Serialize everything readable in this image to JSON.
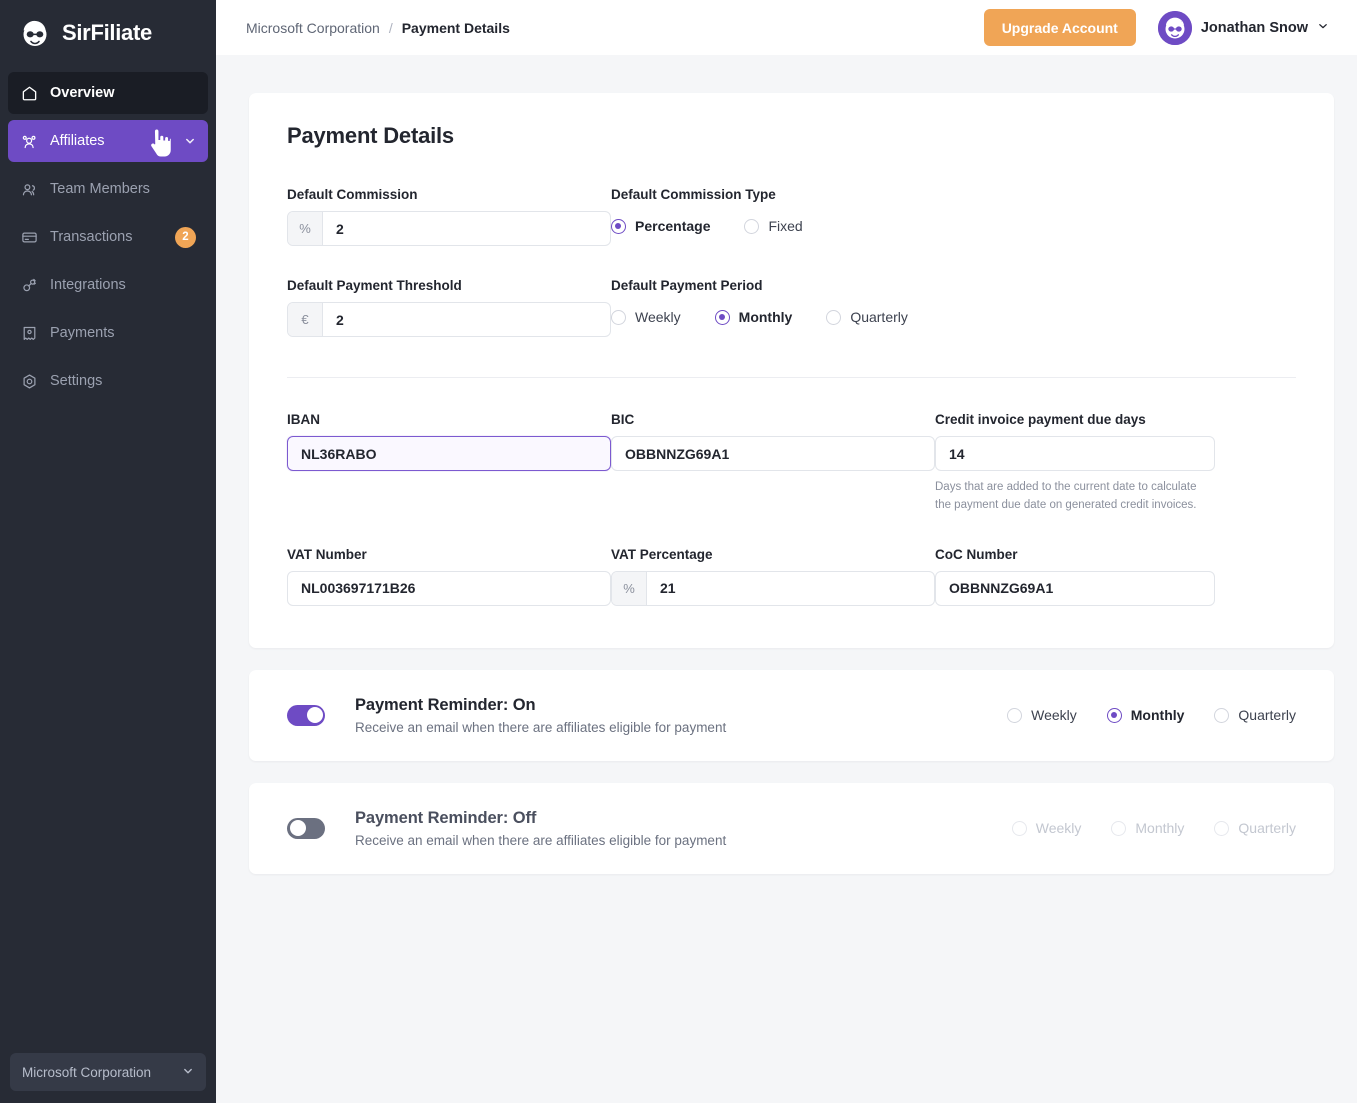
{
  "brand": {
    "name": "SirFiliate",
    "logo_icon": "mascot-logo-icon"
  },
  "sidebar": {
    "items": [
      {
        "label": "Overview",
        "icon": "home-icon",
        "state": "active-dark"
      },
      {
        "label": "Affiliates",
        "icon": "affiliates-group-icon",
        "state": "active-purple",
        "has_chevron": true
      },
      {
        "label": "Team Members",
        "icon": "team-members-icon",
        "state": "normal"
      },
      {
        "label": "Transactions",
        "icon": "card-icon",
        "state": "normal",
        "badge": "2"
      },
      {
        "label": "Integrations",
        "icon": "integrations-plug-icon",
        "state": "normal"
      },
      {
        "label": "Payments",
        "icon": "receipt-icon",
        "state": "normal"
      },
      {
        "label": "Settings",
        "icon": "gear-hexagon-icon",
        "state": "normal"
      }
    ],
    "org_switcher": {
      "label": "Microsoft Corporation",
      "icon": "chevron-down-icon"
    }
  },
  "header": {
    "breadcrumb_root": "Microsoft Corporation",
    "breadcrumb_separator": "/",
    "breadcrumb_current": "Payment Details",
    "upgrade_label": "Upgrade Account",
    "user_name": "Jonathan Snow",
    "user_caret_icon": "chevron-down-icon",
    "avatar_icon": "user-avatar-icon"
  },
  "main": {
    "page_title": "Payment Details",
    "fields": {
      "default_commission": {
        "label": "Default Commission",
        "prefix": "%",
        "value": "2",
        "placeholder": ""
      },
      "default_commission_type": {
        "label": "Default Commission Type",
        "options": [
          {
            "label": "Percentage",
            "checked": true
          },
          {
            "label": "Fixed",
            "checked": false
          }
        ]
      },
      "default_payment_threshold": {
        "label": "Default Payment Threshold",
        "prefix": "€",
        "value": "2",
        "placeholder": ""
      },
      "default_payment_period": {
        "label": "Default Payment Period",
        "options": [
          {
            "label": "Weekly",
            "checked": false
          },
          {
            "label": "Monthly",
            "checked": true
          },
          {
            "label": "Quarterly",
            "checked": false
          }
        ]
      },
      "iban": {
        "label": "IBAN",
        "value": "NL36RABO",
        "placeholder": "",
        "focused": true
      },
      "bic": {
        "label": "BIC",
        "value": "OBBNNZG69A1",
        "placeholder": ""
      },
      "credit_invoice_due_days": {
        "label": "Credit invoice payment due days",
        "value": "14",
        "placeholder": "",
        "hint": "Days that are added to the current date to calculate the payment due date on generated credit invoices."
      },
      "vat_number": {
        "label": "VAT Number",
        "value": "NL003697171B26",
        "placeholder": ""
      },
      "vat_percentage": {
        "label": "VAT Percentage",
        "prefix": "%",
        "value": "21",
        "placeholder": ""
      },
      "coc_number": {
        "label": "CoC Number",
        "value": "OBBNNZG69A1",
        "placeholder": ""
      }
    },
    "reminder_on": {
      "title": "Payment Reminder: On",
      "description": "Receive an email when there are affiliates eligible for payment",
      "toggle_state": "on",
      "options": [
        {
          "label": "Weekly",
          "checked": false
        },
        {
          "label": "Monthly",
          "checked": true
        },
        {
          "label": "Quarterly",
          "checked": false
        }
      ]
    },
    "reminder_off": {
      "title": "Payment Reminder: Off",
      "description": "Receive an email when there are affiliates eligible for payment",
      "toggle_state": "off",
      "options": [
        {
          "label": "Weekly",
          "checked": false
        },
        {
          "label": "Monthly",
          "checked": false
        },
        {
          "label": "Quarterly",
          "checked": false
        }
      ]
    }
  },
  "colors": {
    "accent_purple": "#6e4bc4",
    "sidebar_bg": "#272b35",
    "sidebar_active_dark": "#1a1d25",
    "upgrade_orange": "#f0a556",
    "badge_orange": "#f0a556",
    "page_bg": "#f5f6f8",
    "card_bg": "#ffffff",
    "text_dark": "#23262f",
    "text_muted": "#8b909d"
  }
}
